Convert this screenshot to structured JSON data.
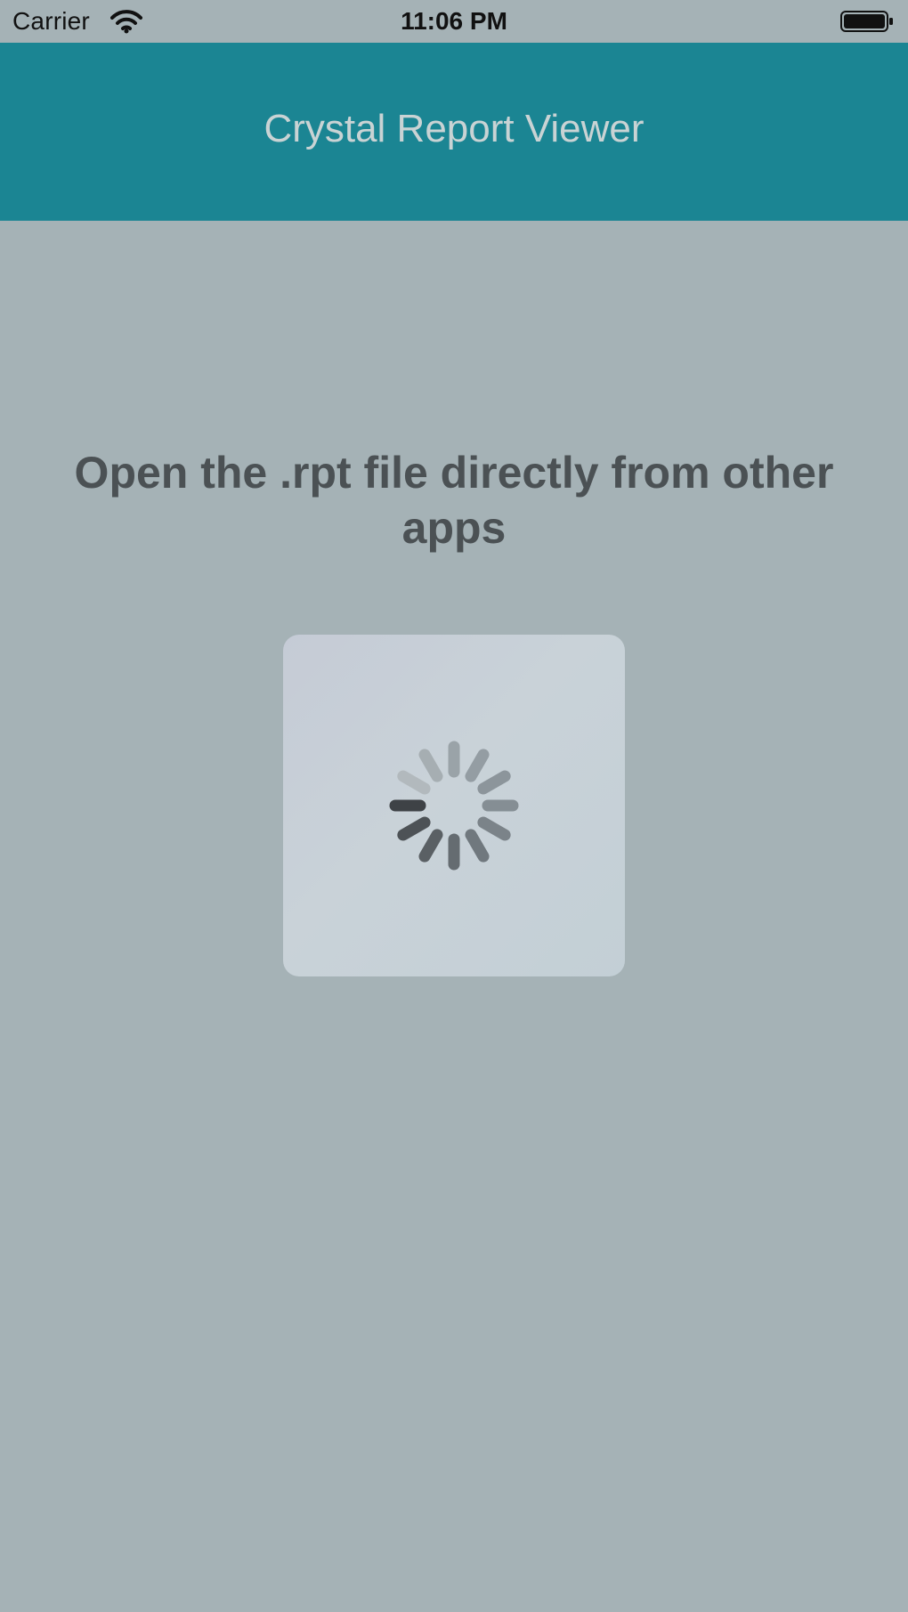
{
  "status_bar": {
    "carrier": "Carrier",
    "time": "11:06 PM",
    "wifi_icon": "wifi-icon",
    "battery_icon": "battery-icon"
  },
  "nav": {
    "title": "Crystal Report Viewer",
    "background_color": "#1b8593"
  },
  "main": {
    "message": "Open the .rpt file directly from other apps",
    "loading_icon": "activity-spinner-icon"
  },
  "colors": {
    "background": "#a5b2b6",
    "message_text": "#4b5154",
    "nav_title_text": "#c9d3d4"
  }
}
